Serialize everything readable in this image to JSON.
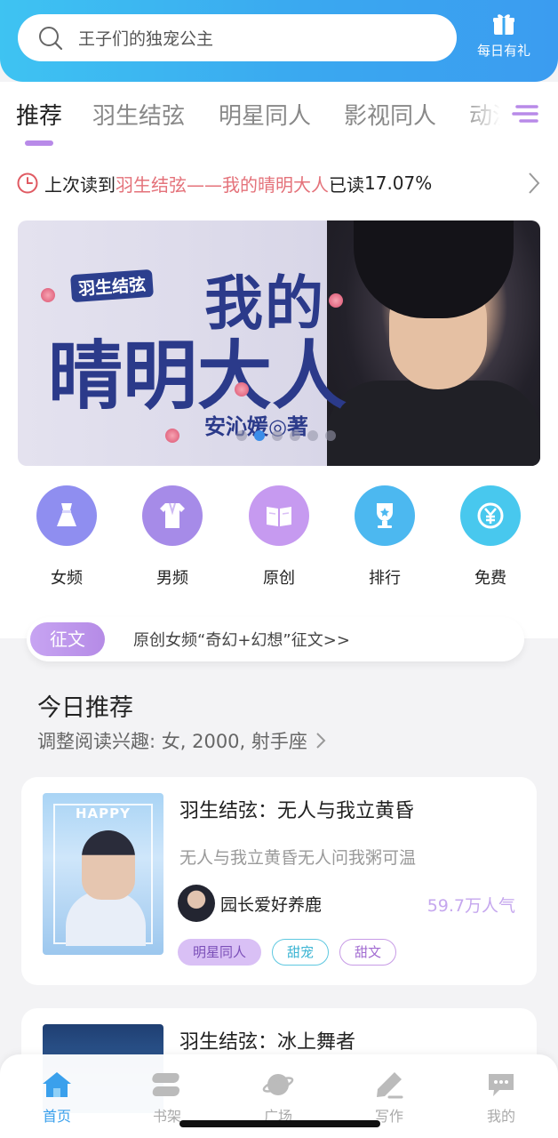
{
  "header": {
    "search_placeholder": "王子们的独宠公主",
    "gift_label": "每日有礼"
  },
  "tabs": [
    {
      "label": "推荐",
      "active": true
    },
    {
      "label": "羽生结弦",
      "active": false
    },
    {
      "label": "明星同人",
      "active": false
    },
    {
      "label": "影视同人",
      "active": false
    },
    {
      "label": "动漫",
      "active": false
    }
  ],
  "last_read": {
    "prefix": "上次读到",
    "book": "羽生结弦——我的晴明大人",
    "progress_label": "已读",
    "progress": "17.07%"
  },
  "banner": {
    "tag": "羽生结弦",
    "title_line1": "我的",
    "title_line2": "晴明大人",
    "author": "安沁媛◎著",
    "slide_count": 6,
    "active_slide": 1
  },
  "categories": [
    {
      "label": "女频",
      "icon": "dress-icon",
      "color": "#8f8ef0"
    },
    {
      "label": "男频",
      "icon": "shirt-icon",
      "color": "#a68be8"
    },
    {
      "label": "原创",
      "icon": "book-icon",
      "color": "#c69af0"
    },
    {
      "label": "排行",
      "icon": "trophy-icon",
      "color": "#4cb8f0"
    },
    {
      "label": "免费",
      "icon": "yen-coin-icon",
      "color": "#48c8ee"
    }
  ],
  "essay": {
    "pill": "征文",
    "text": "原创女频“奇幻+幻想”征文>>"
  },
  "recommend": {
    "title": "今日推荐",
    "subtitle": "调整阅读兴趣: 女, 2000, 射手座"
  },
  "books": [
    {
      "name": "羽生结弦：无人与我立黄昏",
      "desc": "无人与我立黄昏无人问我粥可温",
      "author": "园长爱好养鹿",
      "popularity": "59.7万人气",
      "cover_text": "HAPPY",
      "tags": [
        "明星同人",
        "甜宠",
        "甜文"
      ]
    },
    {
      "name": "羽生结弦：冰上舞者"
    }
  ],
  "bottom_nav": [
    {
      "label": "首页",
      "icon": "home-icon",
      "active": true
    },
    {
      "label": "书架",
      "icon": "bookshelf-icon",
      "active": false
    },
    {
      "label": "广场",
      "icon": "planet-icon",
      "active": false
    },
    {
      "label": "写作",
      "icon": "pen-icon",
      "active": false
    },
    {
      "label": "我的",
      "icon": "chat-bubble-icon",
      "active": false
    }
  ],
  "colors": {
    "header_start": "#3ec3f2",
    "header_end": "#3b9cf0",
    "accent_purple": "#b88ae8",
    "highlight_red": "#e4727a",
    "nav_active": "#3aa0ec"
  }
}
